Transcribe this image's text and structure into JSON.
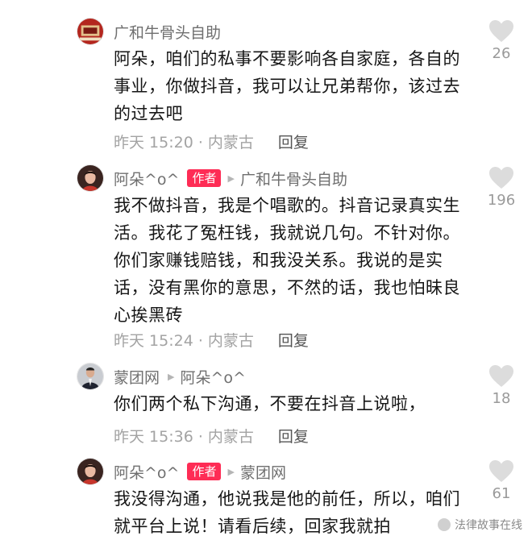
{
  "comments": [
    {
      "username": "广和牛骨头自助",
      "is_author": false,
      "reply_to": "",
      "text": "阿朵，咱们的私事不要影响各自家庭，各自的事业，你做抖音，我可以让兄弟帮你，该过去的过去吧",
      "timestamp": "昨天 15:20 · 内蒙古",
      "reply_label": "回复",
      "likes": "26",
      "avatar_icon": "restaurant-logo-avatar"
    },
    {
      "username": "阿朵^o^",
      "is_author": true,
      "author_badge": "作者",
      "reply_to": "广和牛骨头自助",
      "text": "我不做抖音，我是个唱歌的。抖音记录真实生活。我花了冤枉钱，我就说几句。不针对你。你们家赚钱赔钱，和我没关系。我说的是实话，没有黑你的意思，不然的话，我也怕昧良心挨黑砖",
      "timestamp": "昨天 15:24 · 内蒙古",
      "reply_label": "回复",
      "likes": "196",
      "avatar_icon": "woman-portrait-avatar"
    },
    {
      "username": "蒙团网",
      "is_author": false,
      "reply_to": "阿朵^o^",
      "text": "你们两个私下沟通，不要在抖音上说啦，",
      "timestamp": "昨天 15:36 · 内蒙古",
      "reply_label": "回复",
      "likes": "18",
      "avatar_icon": "man-in-suit-avatar"
    },
    {
      "username": "阿朵^o^",
      "is_author": true,
      "author_badge": "作者",
      "reply_to": "蒙团网",
      "text": "我没得沟通，他说我是他的前任，所以，咱们就平台上说！请看后续，回家我就拍",
      "timestamp": "",
      "reply_label": "",
      "likes": "61",
      "avatar_icon": "woman-portrait-avatar"
    }
  ],
  "watermark": {
    "text": "法律故事在线"
  },
  "colors": {
    "author_badge": "#fe2c55",
    "meta_text": "#6f6f6f",
    "foot_text": "#a3a3a3",
    "heart": "#dcdcdc"
  },
  "icons": {
    "like": "heart-icon",
    "reply_arrow": "triangle-right-icon"
  }
}
